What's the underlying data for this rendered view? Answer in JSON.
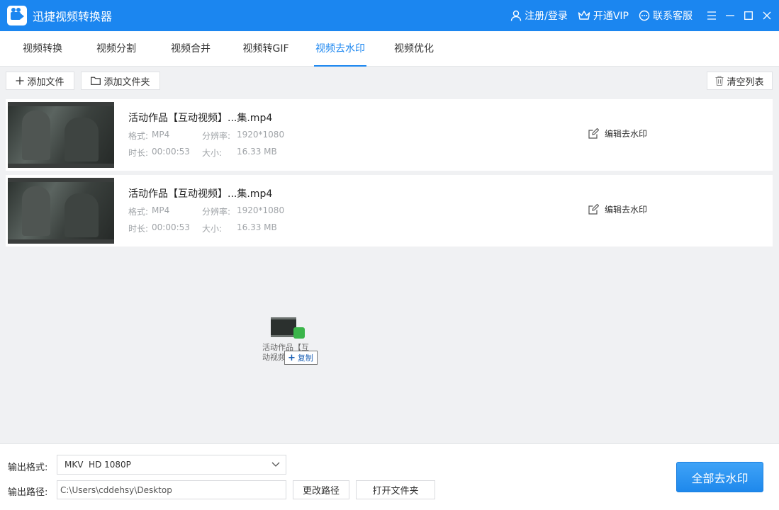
{
  "app": {
    "title": "迅捷视频转换器",
    "brand_color": "#1b86f0",
    "header": {
      "login": "注册/登录",
      "vip": "开通VIP",
      "support": "联系客服"
    }
  },
  "tabs": [
    {
      "label": "视频转换",
      "active": false
    },
    {
      "label": "视频分割",
      "active": false
    },
    {
      "label": "视频合并",
      "active": false
    },
    {
      "label": "视频转GIF",
      "active": false
    },
    {
      "label": "视频去水印",
      "active": true
    },
    {
      "label": "视频优化",
      "active": false
    }
  ],
  "toolbar": {
    "add_file": "添加文件",
    "add_folder": "添加文件夹",
    "clear_list": "清空列表"
  },
  "files": [
    {
      "name": "活动作品【互动视频】...集.mp4",
      "format_label": "格式:",
      "format": "MP4",
      "resolution_label": "分辨率:",
      "resolution": "1920*1080",
      "duration_label": "时长:",
      "duration": "00:00:53",
      "size_label": "大小:",
      "size": "16.33 MB",
      "action": "编辑去水印"
    },
    {
      "name": "活动作品【互动视频】...集.mp4",
      "format_label": "格式:",
      "format": "MP4",
      "resolution_label": "分辨率:",
      "resolution": "1920*1080",
      "duration_label": "时长:",
      "duration": "00:00:53",
      "size_label": "大小:",
      "size": "16.33 MB",
      "action": "编辑去水印"
    }
  ],
  "drag": {
    "filename_line1": "活动作品【互",
    "filename_line2": "动视频",
    "tip": "复制"
  },
  "bottom": {
    "format_label": "输出格式:",
    "format_value": "MKV  HD 1080P",
    "path_label": "输出路径:",
    "path_value": "C:\\Users\\cddehsy\\Desktop",
    "change_path": "更改路径",
    "open_folder": "打开文件夹",
    "run_all": "全部去水印"
  }
}
